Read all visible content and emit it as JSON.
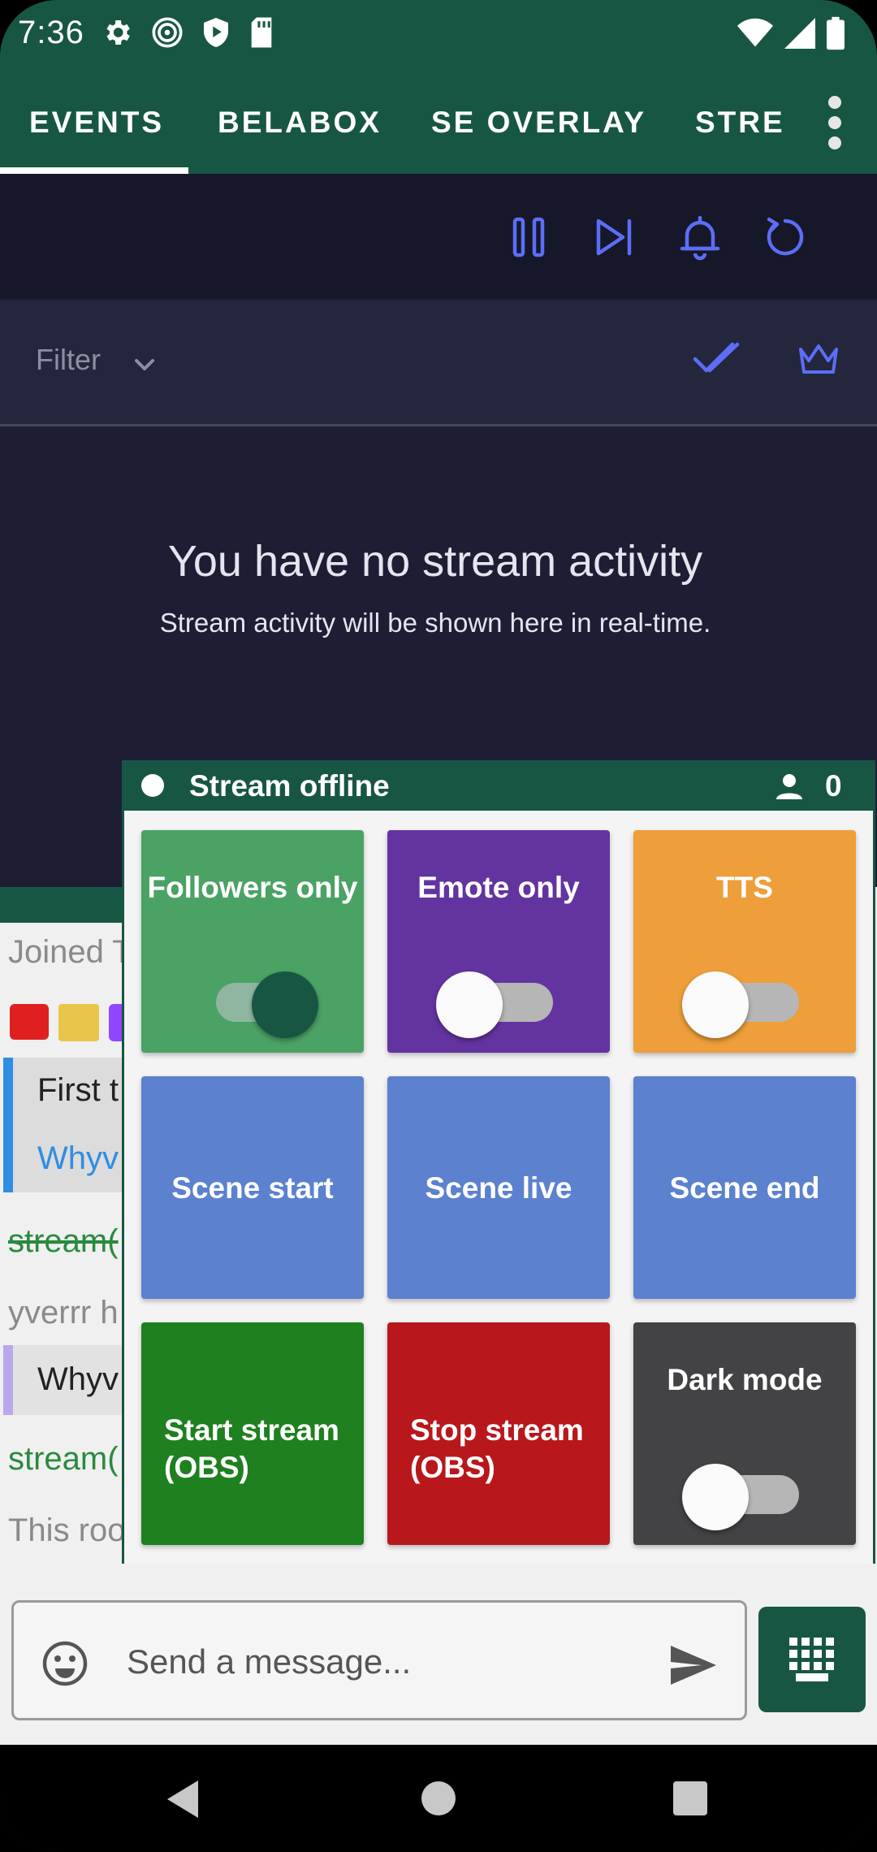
{
  "status_bar": {
    "time": "7:36",
    "icons": [
      "gear-icon",
      "spiral-icon",
      "shield-play-icon",
      "sd-card-icon",
      "wifi-icon",
      "signal-icon",
      "battery-icon"
    ]
  },
  "tabs": [
    {
      "label": "EVENTS",
      "selected": true
    },
    {
      "label": "BELABOX",
      "selected": false
    },
    {
      "label": "SE OVERLAY",
      "selected": false
    },
    {
      "label": "STRE",
      "selected": false
    }
  ],
  "toolbar": {
    "icons": [
      "pause-icon",
      "skip-next-icon",
      "bell-icon",
      "refresh-icon"
    ]
  },
  "filter": {
    "label": "Filter",
    "icons": [
      "double-check-icon",
      "crown-icon"
    ]
  },
  "empty_state": {
    "title": "You have no stream activity",
    "subtitle": "Stream activity will be shown here in real-time."
  },
  "chat": {
    "lines": [
      "Joined T",
      "First t",
      "Whyv",
      "stream(",
      "yverrr h",
      "Whyv",
      "stream(",
      "This roo"
    ]
  },
  "panel": {
    "status": "Stream offline",
    "viewer_count": "0",
    "tiles": [
      {
        "label": "Followers only",
        "toggle": true
      },
      {
        "label": "Emote only",
        "toggle": false
      },
      {
        "label": "TTS",
        "toggle": false
      },
      {
        "label": "Scene start"
      },
      {
        "label": "Scene live"
      },
      {
        "label": "Scene end"
      },
      {
        "label_line1": "Start stream",
        "label_line2": "(OBS)"
      },
      {
        "label_line1": "Stop stream",
        "label_line2": "(OBS)"
      },
      {
        "label": "Dark mode",
        "toggle": false
      }
    ]
  },
  "input": {
    "placeholder": "Send a message..."
  },
  "colors": {
    "brand_green": "#185644",
    "accent_blue": "#5b6ef5",
    "followers_tile": "#4aa264",
    "emote_tile": "#6334a0",
    "tts_tile": "#ee9e3a",
    "scene_tile": "#5b81cf",
    "start_tile": "#1e801e",
    "stop_tile": "#b8181c",
    "dark_tile": "#434245"
  }
}
